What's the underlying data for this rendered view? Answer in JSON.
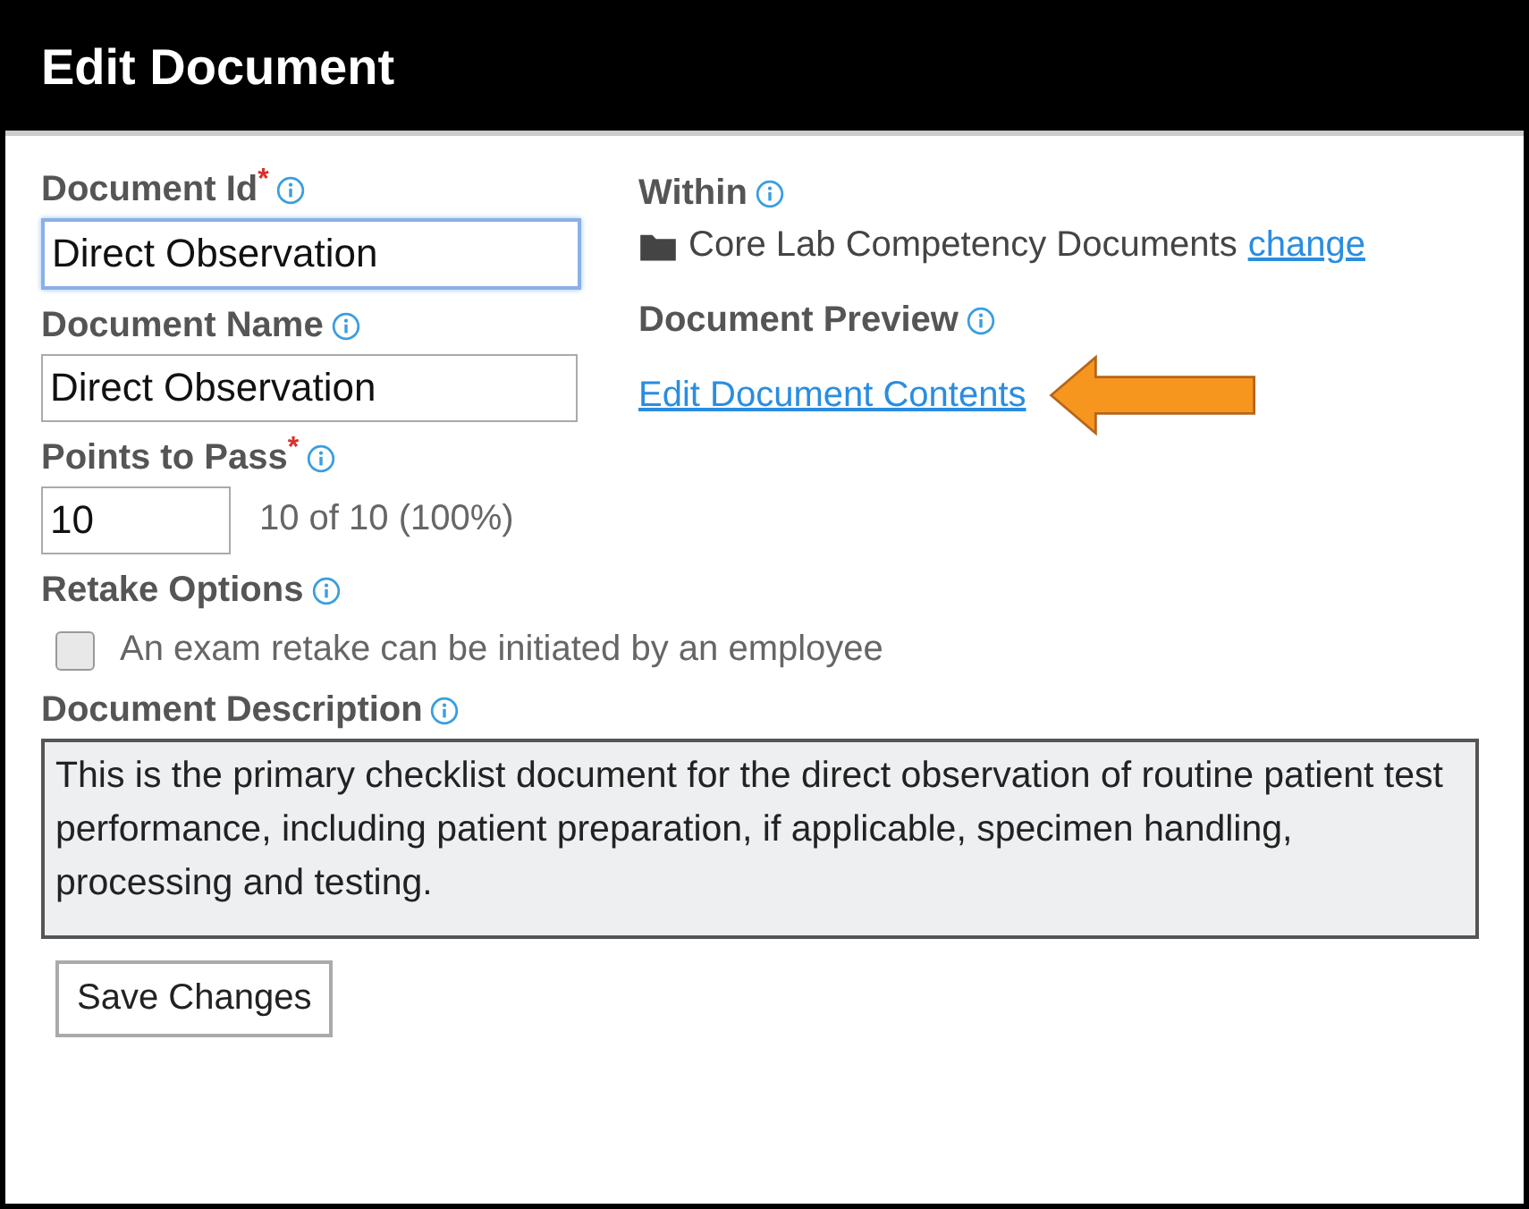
{
  "header": {
    "title": "Edit Document"
  },
  "fields": [
    {
      "label": "Document Id",
      "required_mark": "*",
      "value": "Direct Observation",
      "focused": true
    },
    {
      "label": "Document Name",
      "value": "Direct Observation",
      "focused": false
    }
  ],
  "points": {
    "label": "Points to Pass",
    "required_mark": "*",
    "value": "10",
    "summary": "10 of 10 (100%)"
  },
  "within": {
    "label": "Within",
    "folder": "Core Lab Competency Documents",
    "link": "change"
  },
  "preview": {
    "label": "Document Preview",
    "link": "Edit Document Contents"
  },
  "retake": {
    "label": "Retake Options",
    "option": "An exam retake can be initiated by an employee",
    "checked": false
  },
  "description": {
    "label": "Document Description",
    "value": "This is the primary checklist document for the direct observation of routine patient test performance, including patient preparation, if applicable, specimen handling, processing and testing."
  },
  "button": "Save Changes"
}
